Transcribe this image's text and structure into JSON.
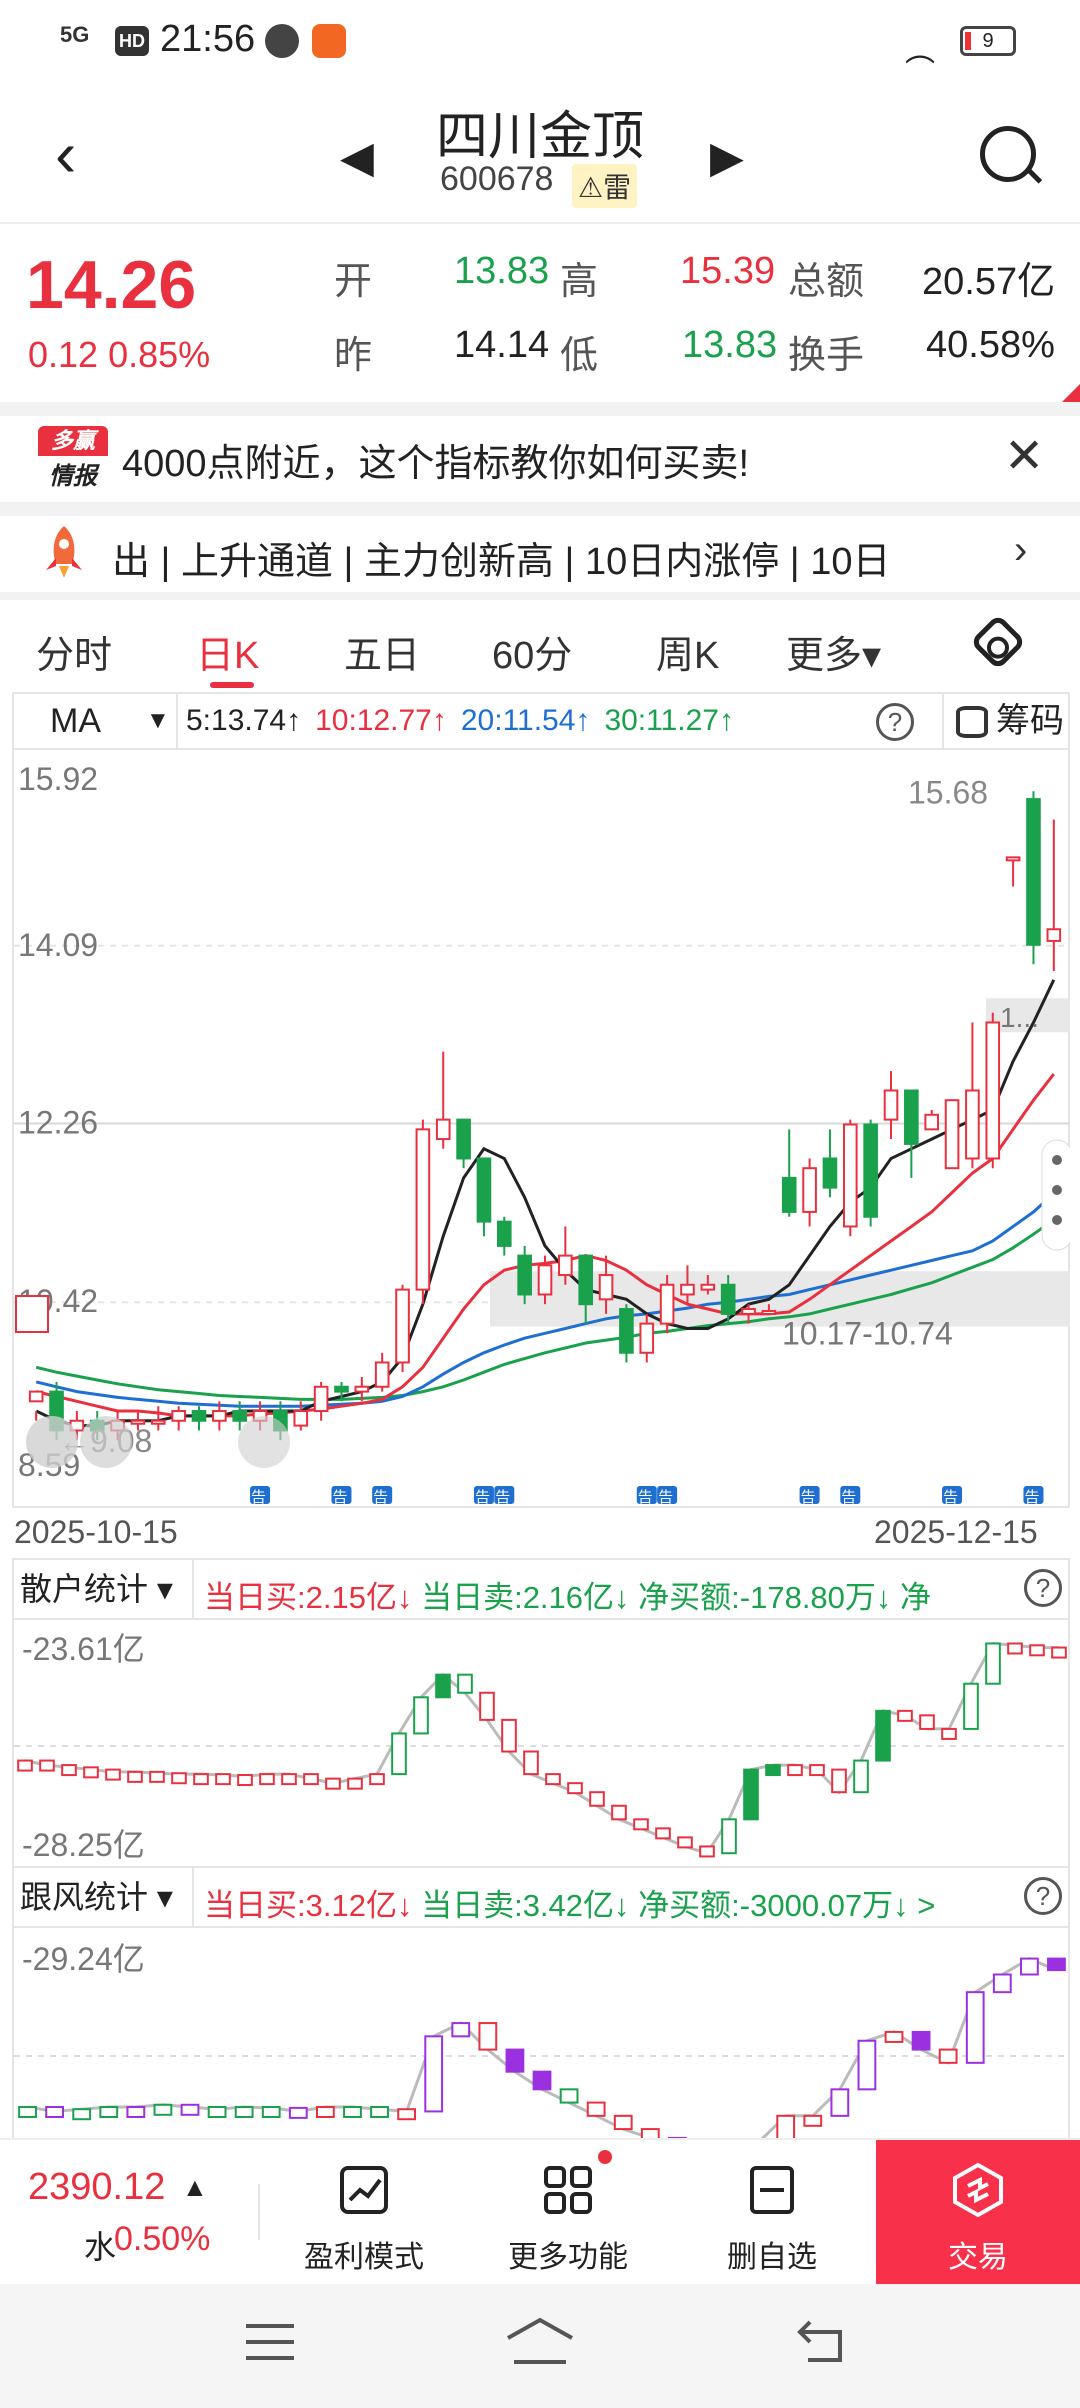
{
  "status_bar": {
    "time": "21:56",
    "network": "5G",
    "hd": "HD",
    "battery": "9"
  },
  "header": {
    "stock_name": "四川金顶",
    "stock_code": "600678",
    "tag": "⚠雷"
  },
  "quote": {
    "price": "14.26",
    "change": "0.12 0.85%",
    "open_label": "开",
    "open": "13.83",
    "high_label": "高",
    "high": "15.39",
    "amount_label": "总额",
    "amount": "20.57亿",
    "prev_label": "昨",
    "prev": "14.14",
    "low_label": "低",
    "low": "13.83",
    "turnover_label": "换手",
    "turnover": "40.58%"
  },
  "news": {
    "logo_top": "多赢",
    "logo_bottom": "情报",
    "text": "4000点附近，这个指标教你如何买卖!"
  },
  "ticker": {
    "text": "出 | 上升通道 | 主力创新高 | 10日内涨停 | 10日"
  },
  "tabs": [
    {
      "label": "分时"
    },
    {
      "label": "日K"
    },
    {
      "label": "五日"
    },
    {
      "label": "60分"
    },
    {
      "label": "周K"
    },
    {
      "label": "更多▾"
    }
  ],
  "ma_bar": {
    "selector": "MA",
    "ma5": "5:13.74↑",
    "ma10": "10:12.77↑",
    "ma20": "20:11.54↑",
    "ma30": "30:11.27↑",
    "chips": "筹码"
  },
  "colors": {
    "up": "#e8303f",
    "down": "#1aa14c",
    "ma5": "#222222",
    "ma10": "#e8303f",
    "ma20": "#1f6fd1",
    "ma30": "#1aa14c",
    "purple": "#9b30e0"
  },
  "chart_data": {
    "type": "candlestick",
    "y_ticks": [
      "15.92",
      "14.09",
      "12.26",
      "10.42",
      "8.59"
    ],
    "ylim": [
      8.59,
      15.92
    ],
    "max_label": "15.68",
    "min_label": "9.08",
    "range_label": "10.17-10.74",
    "box_label": "1...",
    "announce_marker": "告",
    "date_start": "2025-10-15",
    "date_end": "2025-12-15",
    "candles": [
      [
        9.4,
        9.5,
        9.3,
        9.2
      ],
      [
        9.5,
        9.1,
        9.6,
        9.0
      ],
      [
        9.1,
        9.2,
        9.3,
        9.0
      ],
      [
        9.2,
        9.1,
        9.3,
        9.0
      ],
      [
        9.1,
        9.2,
        9.3,
        9.0
      ],
      [
        9.2,
        9.2,
        9.3,
        9.1
      ],
      [
        9.2,
        9.2,
        9.35,
        9.1
      ],
      [
        9.2,
        9.3,
        9.35,
        9.1
      ],
      [
        9.3,
        9.2,
        9.35,
        9.1
      ],
      [
        9.2,
        9.3,
        9.4,
        9.1
      ],
      [
        9.3,
        9.2,
        9.4,
        9.1
      ],
      [
        9.2,
        9.3,
        9.4,
        9.1
      ],
      [
        9.3,
        9.1,
        9.4,
        9.0
      ],
      [
        9.15,
        9.3,
        9.4,
        9.1
      ],
      [
        9.3,
        9.55,
        9.6,
        9.2
      ],
      [
        9.55,
        9.5,
        9.6,
        9.4
      ],
      [
        9.5,
        9.55,
        9.65,
        9.4
      ],
      [
        9.55,
        9.8,
        9.9,
        9.5
      ],
      [
        9.8,
        10.55,
        10.6,
        9.7
      ],
      [
        10.55,
        12.2,
        12.3,
        10.4
      ],
      [
        12.1,
        12.3,
        13.0,
        12.0
      ],
      [
        12.3,
        11.9,
        12.3,
        11.8
      ],
      [
        11.9,
        11.25,
        11.9,
        11.1
      ],
      [
        11.25,
        11.0,
        11.3,
        10.9
      ],
      [
        10.9,
        10.5,
        11.0,
        10.4
      ],
      [
        10.5,
        10.8,
        10.9,
        10.4
      ],
      [
        10.7,
        10.9,
        11.2,
        10.6
      ],
      [
        10.9,
        10.4,
        10.9,
        10.2
      ],
      [
        10.45,
        10.7,
        10.9,
        10.3
      ],
      [
        10.35,
        9.9,
        10.4,
        9.8
      ],
      [
        9.9,
        10.2,
        10.3,
        9.8
      ],
      [
        10.2,
        10.6,
        10.7,
        10.1
      ],
      [
        10.5,
        10.6,
        10.8,
        10.4
      ],
      [
        10.55,
        10.6,
        10.7,
        10.5
      ],
      [
        10.6,
        10.3,
        10.7,
        10.2
      ],
      [
        10.3,
        10.35,
        10.4,
        10.2
      ],
      [
        10.3,
        10.33,
        10.4,
        10.3
      ],
      [
        11.7,
        11.35,
        12.2,
        11.3
      ],
      [
        11.35,
        11.8,
        11.9,
        11.2
      ],
      [
        11.9,
        11.6,
        12.2,
        11.5
      ],
      [
        11.2,
        12.25,
        12.3,
        11.1
      ],
      [
        12.25,
        11.3,
        12.3,
        11.2
      ],
      [
        12.3,
        12.6,
        12.8,
        12.1
      ],
      [
        12.6,
        12.05,
        12.6,
        11.7
      ],
      [
        12.2,
        12.35,
        12.4,
        12.2
      ],
      [
        11.8,
        12.5,
        12.5,
        11.8
      ],
      [
        11.9,
        12.6,
        13.3,
        11.8
      ],
      [
        11.9,
        13.3,
        13.4,
        11.8
      ],
      [
        15.0,
        15.0,
        15.0,
        14.7
      ],
      [
        15.6,
        14.1,
        15.68,
        13.9
      ],
      [
        14.14,
        14.26,
        15.39,
        13.83
      ]
    ],
    "ma5": [
      9.3,
      9.2,
      9.15,
      9.15,
      9.2,
      9.2,
      9.2,
      9.25,
      9.25,
      9.25,
      9.3,
      9.3,
      9.3,
      9.3,
      9.4,
      9.45,
      9.5,
      9.6,
      9.85,
      10.4,
      11.1,
      11.7,
      12.0,
      11.9,
      11.5,
      11.0,
      10.75,
      10.55,
      10.5,
      10.45,
      10.3,
      10.2,
      10.15,
      10.15,
      10.25,
      10.4,
      10.45,
      10.6,
      10.9,
      11.2,
      11.45,
      11.6,
      11.9,
      12.0,
      12.1,
      12.2,
      12.3,
      12.4,
      12.9,
      13.3,
      13.74
    ],
    "ma10": [
      9.5,
      9.45,
      9.4,
      9.35,
      9.3,
      9.3,
      9.28,
      9.25,
      9.25,
      9.25,
      9.25,
      9.27,
      9.28,
      9.3,
      9.32,
      9.35,
      9.38,
      9.42,
      9.55,
      9.75,
      10.05,
      10.35,
      10.6,
      10.75,
      10.8,
      10.82,
      10.85,
      10.9,
      10.85,
      10.75,
      10.6,
      10.5,
      10.4,
      10.35,
      10.3,
      10.3,
      10.3,
      10.32,
      10.45,
      10.6,
      10.75,
      10.9,
      11.05,
      11.2,
      11.35,
      11.55,
      11.75,
      11.9,
      12.2,
      12.5,
      12.77
    ],
    "ma20": [
      9.6,
      9.55,
      9.5,
      9.47,
      9.44,
      9.42,
      9.4,
      9.38,
      9.37,
      9.36,
      9.35,
      9.35,
      9.35,
      9.35,
      9.36,
      9.37,
      9.38,
      9.4,
      9.45,
      9.55,
      9.68,
      9.8,
      9.9,
      9.98,
      10.05,
      10.1,
      10.15,
      10.2,
      10.25,
      10.28,
      10.3,
      10.33,
      10.36,
      10.4,
      10.42,
      10.45,
      10.48,
      10.5,
      10.55,
      10.6,
      10.65,
      10.7,
      10.75,
      10.8,
      10.85,
      10.9,
      10.95,
      11.05,
      11.2,
      11.35,
      11.54
    ],
    "ma30": [
      9.75,
      9.7,
      9.66,
      9.62,
      9.58,
      9.55,
      9.52,
      9.5,
      9.48,
      9.46,
      9.45,
      9.44,
      9.43,
      9.42,
      9.42,
      9.42,
      9.43,
      9.44,
      9.46,
      9.5,
      9.55,
      9.62,
      9.7,
      9.78,
      9.84,
      9.9,
      9.95,
      10.0,
      10.03,
      10.06,
      10.1,
      10.12,
      10.15,
      10.18,
      10.2,
      10.22,
      10.25,
      10.27,
      10.3,
      10.35,
      10.4,
      10.45,
      10.5,
      10.56,
      10.62,
      10.7,
      10.78,
      10.86,
      10.98,
      11.12,
      11.27
    ]
  },
  "retail_panel": {
    "selector": "散户统计 ▾",
    "buy": "当日买:2.15亿↓",
    "sell": "当日卖:2.16亿↓",
    "net": "净买额:-178.80万↓",
    "net_more": "净",
    "top_label": "-23.61亿",
    "bottom_label": "-28.25亿",
    "values": [
      -26.2,
      -26.3,
      -26.35,
      -26.4,
      -26.45,
      -26.45,
      -26.48,
      -26.5,
      -26.5,
      -26.52,
      -26.55,
      -26.5,
      -26.5,
      -26.6,
      -26.7,
      -26.6,
      -26.5,
      -25.6,
      -24.8,
      -24.3,
      -24.7,
      -25.3,
      -26.0,
      -26.5,
      -26.7,
      -26.9,
      -27.2,
      -27.5,
      -27.7,
      -27.9,
      -28.1,
      -28.25,
      -27.5,
      -26.4,
      -26.3,
      -26.3,
      -26.4,
      -26.9,
      -26.2,
      -25.1,
      -25.2,
      -25.5,
      -25.5,
      -24.5,
      -23.61,
      -23.65,
      -23.7,
      -23.7
    ],
    "kinds": [
      0,
      0,
      0,
      0,
      0,
      0,
      0,
      0,
      0,
      0,
      0,
      0,
      0,
      0,
      0,
      0,
      0,
      1,
      1,
      2,
      1,
      0,
      0,
      0,
      0,
      0,
      0,
      0,
      0,
      0,
      0,
      0,
      1,
      3,
      3,
      0,
      0,
      0,
      1,
      3,
      0,
      0,
      0,
      1,
      1,
      0,
      0,
      0
    ]
  },
  "follow_panel": {
    "selector": "跟风统计 ▾",
    "buy": "当日买:3.12亿↓",
    "sell": "当日卖:3.42亿↓",
    "net": "净买额:-3000.07万↓",
    "net_more": ">",
    "top_label": "-29.24亿",
    "values": [
      -32.6,
      -32.7,
      -32.65,
      -32.6,
      -32.6,
      -32.55,
      -32.6,
      -32.65,
      -32.6,
      -32.62,
      -32.7,
      -32.6,
      -32.6,
      -32.65,
      -32.7,
      -31.0,
      -30.7,
      -31.3,
      -31.8,
      -32.2,
      -32.5,
      -32.8,
      -33.1,
      -33.3,
      -33.4,
      -33.5,
      -33.6,
      -33.4,
      -32.8,
      -32.8,
      -32.2,
      -31.1,
      -30.9,
      -31.3,
      -31.6,
      -30.0,
      -29.6,
      -29.24,
      -29.5
    ],
    "kinds": [
      1,
      4,
      1,
      1,
      4,
      1,
      4,
      1,
      1,
      1,
      4,
      0,
      1,
      1,
      0,
      4,
      4,
      0,
      3,
      3,
      1,
      0,
      0,
      0,
      4,
      0,
      4,
      0,
      0,
      0,
      4,
      4,
      0,
      3,
      0,
      4,
      4,
      4,
      3
    ]
  },
  "bottom_bar": {
    "index_value": "2390.12",
    "index_arrow": "▲",
    "index_mark": "水",
    "index_change": "0.50%",
    "profit_mode": "盈利模式",
    "more_functions": "更多功能",
    "remove_watch": "删自选",
    "trade": "交易"
  }
}
